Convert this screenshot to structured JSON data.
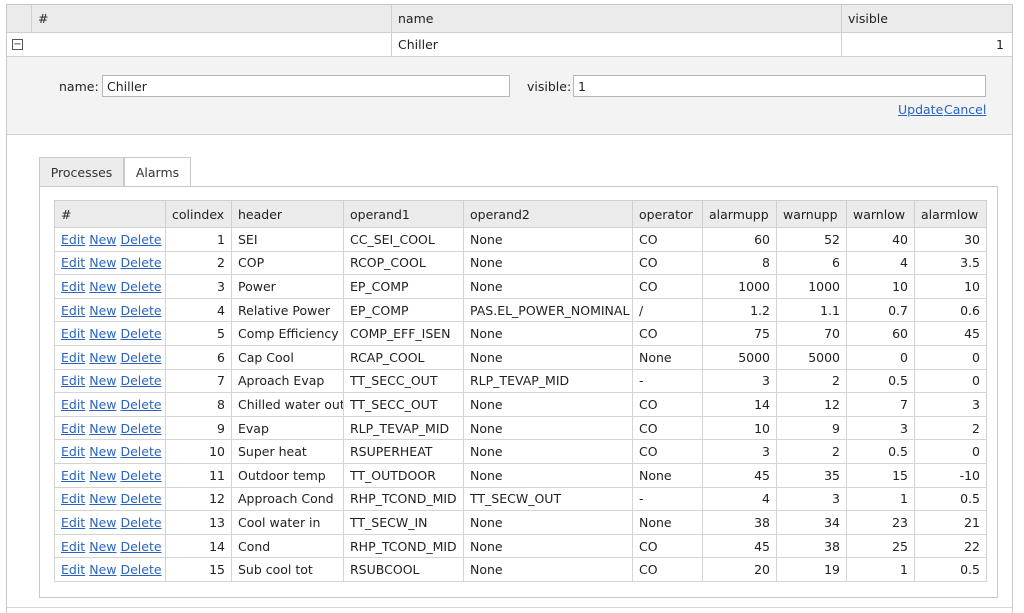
{
  "grid": {
    "columns": [
      "#",
      "name",
      "visible"
    ],
    "row": {
      "name": "Chiller",
      "visible": "1"
    }
  },
  "edit_form": {
    "name_label": "name:",
    "name_value": "Chiller",
    "visible_label": "visible:",
    "visible_value": "1",
    "update_label": "Update",
    "cancel_label": "Cancel"
  },
  "tabs": [
    {
      "label": "Processes",
      "active": false
    },
    {
      "label": "Alarms",
      "active": true
    }
  ],
  "alarms_table": {
    "columns": [
      "#",
      "colindex",
      "header",
      "operand1",
      "operand2",
      "operator",
      "alarmupp",
      "warnupp",
      "warnlow",
      "alarmlow"
    ],
    "actions": [
      "Edit",
      "New",
      "Delete"
    ],
    "rows": [
      {
        "colindex": "1",
        "header": "SEI",
        "operand1": "CC_SEI_COOL",
        "operand2": "None",
        "operator": "CO",
        "alarmupp": "60",
        "warnupp": "52",
        "warnlow": "40",
        "alarmlow": "30"
      },
      {
        "colindex": "2",
        "header": "COP",
        "operand1": "RCOP_COOL",
        "operand2": "None",
        "operator": "CO",
        "alarmupp": "8",
        "warnupp": "6",
        "warnlow": "4",
        "alarmlow": "3.5"
      },
      {
        "colindex": "3",
        "header": "Power",
        "operand1": "EP_COMP",
        "operand2": "None",
        "operator": "CO",
        "alarmupp": "1000",
        "warnupp": "1000",
        "warnlow": "10",
        "alarmlow": "10"
      },
      {
        "colindex": "4",
        "header": "Relative Power",
        "operand1": "EP_COMP",
        "operand2": "PAS.EL_POWER_NOMINAL",
        "operator": "/",
        "alarmupp": "1.2",
        "warnupp": "1.1",
        "warnlow": "0.7",
        "alarmlow": "0.6"
      },
      {
        "colindex": "5",
        "header": "Comp Efficiency",
        "operand1": "COMP_EFF_ISEN",
        "operand2": "None",
        "operator": "CO",
        "alarmupp": "75",
        "warnupp": "70",
        "warnlow": "60",
        "alarmlow": "45"
      },
      {
        "colindex": "6",
        "header": "Cap Cool",
        "operand1": "RCAP_COOL",
        "operand2": "None",
        "operator": "None",
        "alarmupp": "5000",
        "warnupp": "5000",
        "warnlow": "0",
        "alarmlow": "0"
      },
      {
        "colindex": "7",
        "header": "Aproach Evap",
        "operand1": "TT_SECC_OUT",
        "operand2": "RLP_TEVAP_MID",
        "operator": "-",
        "alarmupp": "3",
        "warnupp": "2",
        "warnlow": "0.5",
        "alarmlow": "0"
      },
      {
        "colindex": "8",
        "header": "Chilled water out",
        "operand1": "TT_SECC_OUT",
        "operand2": "None",
        "operator": "CO",
        "alarmupp": "14",
        "warnupp": "12",
        "warnlow": "7",
        "alarmlow": "3"
      },
      {
        "colindex": "9",
        "header": "Evap",
        "operand1": "RLP_TEVAP_MID",
        "operand2": "None",
        "operator": "CO",
        "alarmupp": "10",
        "warnupp": "9",
        "warnlow": "3",
        "alarmlow": "2"
      },
      {
        "colindex": "10",
        "header": "Super heat",
        "operand1": "RSUPERHEAT",
        "operand2": "None",
        "operator": "CO",
        "alarmupp": "3",
        "warnupp": "2",
        "warnlow": "0.5",
        "alarmlow": "0"
      },
      {
        "colindex": "11",
        "header": "Outdoor temp",
        "operand1": "TT_OUTDOOR",
        "operand2": "None",
        "operator": "None",
        "alarmupp": "45",
        "warnupp": "35",
        "warnlow": "15",
        "alarmlow": "-10"
      },
      {
        "colindex": "12",
        "header": "Approach Cond",
        "operand1": "RHP_TCOND_MID",
        "operand2": "TT_SECW_OUT",
        "operator": "-",
        "alarmupp": "4",
        "warnupp": "3",
        "warnlow": "1",
        "alarmlow": "0.5"
      },
      {
        "colindex": "13",
        "header": "Cool water in",
        "operand1": "TT_SECW_IN",
        "operand2": "None",
        "operator": "None",
        "alarmupp": "38",
        "warnupp": "34",
        "warnlow": "23",
        "alarmlow": "21"
      },
      {
        "colindex": "14",
        "header": "Cond",
        "operand1": "RHP_TCOND_MID",
        "operand2": "None",
        "operator": "CO",
        "alarmupp": "45",
        "warnupp": "38",
        "warnlow": "25",
        "alarmlow": "22"
      },
      {
        "colindex": "15",
        "header": "Sub cool tot",
        "operand1": "RSUBCOOL",
        "operand2": "None",
        "operator": "CO",
        "alarmupp": "20",
        "warnupp": "19",
        "warnlow": "1",
        "alarmlow": "0.5"
      }
    ]
  },
  "colors": {
    "link": "#2a63c1",
    "header_bg": "#ebebeb",
    "panel_bg": "#f3f3f3",
    "border": "#cfcfcf"
  },
  "icons": {
    "collapse": "minus-box-icon"
  }
}
